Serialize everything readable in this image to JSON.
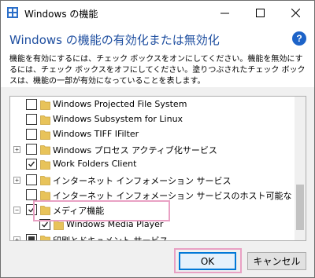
{
  "window": {
    "title": "Windows の機能",
    "heading": "Windows の機能の有効化または無効化",
    "description": "機能を有効にするには、チェック ボックスをオンにしてください。機能を無効にするには、チェック ボックスをオフにしてください。塗りつぶされたチェック ボックスは、機能の一部が有効になっていることを表します。"
  },
  "features": [
    {
      "label": "Windows Projected File System",
      "state": "unchecked",
      "expandable": false,
      "indent": 0
    },
    {
      "label": "Windows Subsystem for Linux",
      "state": "unchecked",
      "expandable": false,
      "indent": 0
    },
    {
      "label": "Windows TIFF IFilter",
      "state": "unchecked",
      "expandable": false,
      "indent": 0
    },
    {
      "label": "Windows プロセス アクティブ化サービス",
      "state": "unchecked",
      "expandable": true,
      "expanded": false,
      "indent": 0
    },
    {
      "label": "Work Folders Client",
      "state": "checked",
      "expandable": false,
      "indent": 0
    },
    {
      "label": "インターネット インフォメーション サービス",
      "state": "unchecked",
      "expandable": true,
      "expanded": false,
      "indent": 0
    },
    {
      "label": "インターネット インフォメーション サービスのホスト可能な Web コア",
      "state": "unchecked",
      "expandable": false,
      "indent": 0
    },
    {
      "label": "メディア機能",
      "state": "checked",
      "expandable": true,
      "expanded": true,
      "indent": 0
    },
    {
      "label": "Windows Media Player",
      "state": "checked",
      "expandable": false,
      "indent": 1
    },
    {
      "label": "印刷とドキュメント サービス",
      "state": "partial",
      "expandable": true,
      "expanded": false,
      "indent": 0
    }
  ],
  "buttons": {
    "ok": "OK",
    "cancel": "キャンセル"
  },
  "icons": {
    "app": "windows-features-icon",
    "folder": "folder-icon",
    "help": "help-icon",
    "minimize": "minimize-icon",
    "maximize": "maximize-icon",
    "close": "close-icon"
  },
  "colors": {
    "heading": "#1f4fa0",
    "help": "#1d63c8",
    "highlight": "#e9a1c4",
    "folder": "#e8c35a"
  },
  "help_glyph": "?",
  "scroll_position": 0.62
}
